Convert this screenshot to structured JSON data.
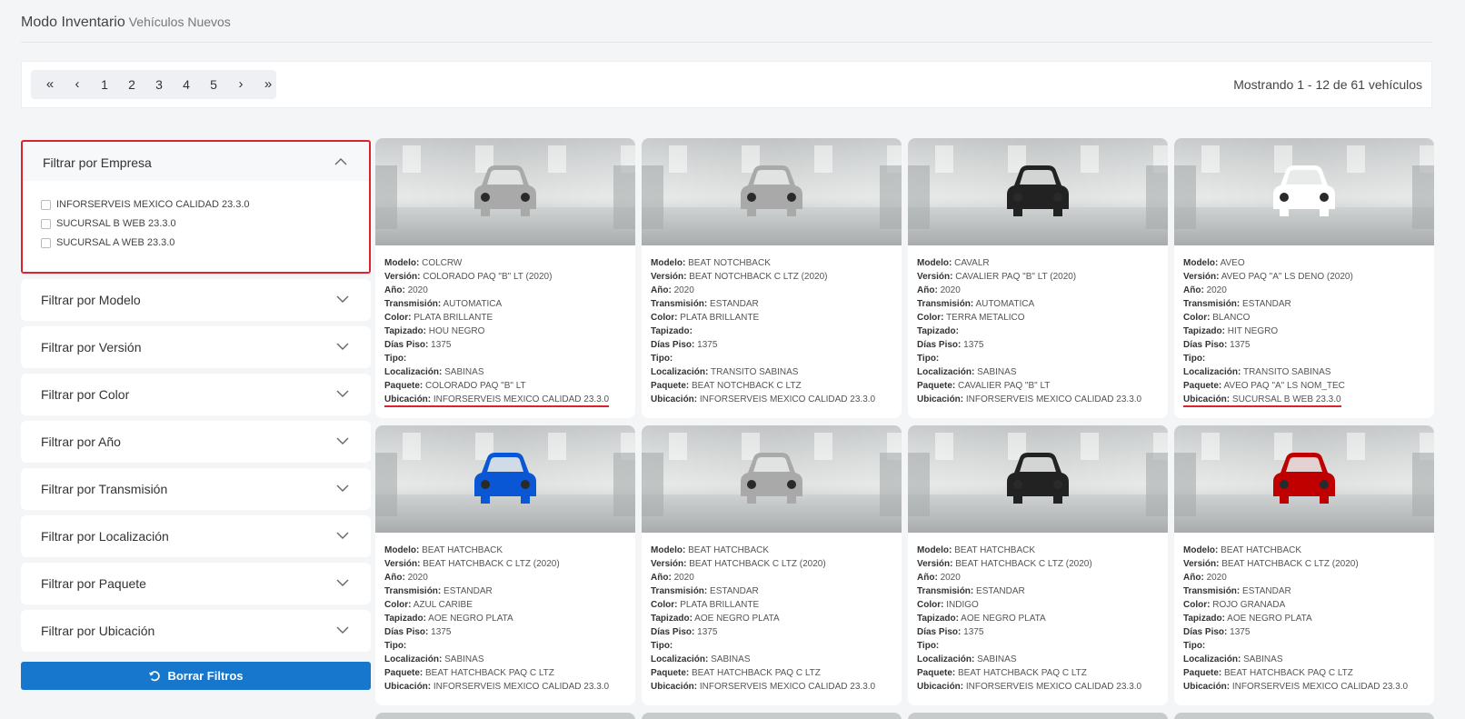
{
  "header": {
    "title": "Modo Inventario",
    "subtitle": "Vehículos Nuevos"
  },
  "pagination": {
    "first": "«",
    "prev": "‹",
    "pages": [
      "1",
      "2",
      "3",
      "4",
      "5"
    ],
    "next": "›",
    "last": "»",
    "showing": "Mostrando 1 - 12 de 61 vehículos"
  },
  "filters": {
    "empresa": {
      "label": "Filtrar por Empresa",
      "options": [
        "INFORSERVEIS MEXICO CALIDAD 23.3.0",
        "SUCURSAL B WEB 23.3.0",
        "SUCURSAL A WEB 23.3.0"
      ]
    },
    "others": [
      "Filtrar por Modelo",
      "Filtrar por Versión",
      "Filtrar por Color",
      "Filtrar por Año",
      "Filtrar por Transmisión",
      "Filtrar por Localización",
      "Filtrar por Paquete",
      "Filtrar por Ubicación"
    ],
    "clear_label": "Borrar Filtros"
  },
  "field_labels": {
    "modelo": "Modelo:",
    "version": "Versión:",
    "anio": "Año:",
    "transmision": "Transmisión:",
    "color": "Color:",
    "tapizado": "Tapizado:",
    "dias": "Días Piso:",
    "tipo": "Tipo:",
    "localizacion": "Localización:",
    "paquete": "Paquete:",
    "ubicacion": "Ubicación:"
  },
  "vehicles": [
    {
      "icon_color": "#a9a9a9",
      "modelo": "COLCRW",
      "version": "COLORADO PAQ \"B\" LT (2020)",
      "anio": "2020",
      "transmision": "AUTOMATICA",
      "color": "PLATA BRILLANTE",
      "tapizado": "HOU NEGRO",
      "dias": "1375",
      "tipo": "",
      "localizacion": "SABINAS",
      "paquete": "COLORADO PAQ \"B\" LT",
      "ubicacion": "INFORSERVEIS MEXICO CALIDAD 23.3.0",
      "highlight": true
    },
    {
      "icon_color": "#a9a9a9",
      "modelo": "BEAT NOTCHBACK",
      "version": "BEAT NOTCHBACK C LTZ (2020)",
      "anio": "2020",
      "transmision": "ESTANDAR",
      "color": "PLATA BRILLANTE",
      "tapizado": "",
      "dias": "1375",
      "tipo": "",
      "localizacion": "TRANSITO SABINAS",
      "paquete": "BEAT NOTCHBACK C LTZ",
      "ubicacion": "INFORSERVEIS MEXICO CALIDAD 23.3.0",
      "highlight": false
    },
    {
      "icon_color": "#222222",
      "modelo": "CAVALR",
      "version": "CAVALIER PAQ \"B\" LT (2020)",
      "anio": "2020",
      "transmision": "AUTOMATICA",
      "color": "TERRA METALICO",
      "tapizado": "",
      "dias": "1375",
      "tipo": "",
      "localizacion": "SABINAS",
      "paquete": "CAVALIER PAQ \"B\" LT",
      "ubicacion": "INFORSERVEIS MEXICO CALIDAD 23.3.0",
      "highlight": false
    },
    {
      "icon_color": "#ffffff",
      "modelo": "AVEO",
      "version": "AVEO PAQ \"A\" LS DENO (2020)",
      "anio": "2020",
      "transmision": "ESTANDAR",
      "color": "BLANCO",
      "tapizado": "HIT NEGRO",
      "dias": "1375",
      "tipo": "",
      "localizacion": "TRANSITO SABINAS",
      "paquete": "AVEO PAQ \"A\" LS NOM_TEC",
      "ubicacion": "SUCURSAL B WEB 23.3.0",
      "highlight": true
    },
    {
      "icon_color": "#0a57d6",
      "modelo": "BEAT HATCHBACK",
      "version": "BEAT HATCHBACK C LTZ (2020)",
      "anio": "2020",
      "transmision": "ESTANDAR",
      "color": "AZUL CARIBE",
      "tapizado": "AOE NEGRO PLATA",
      "dias": "1375",
      "tipo": "",
      "localizacion": "SABINAS",
      "paquete": "BEAT HATCHBACK PAQ C LTZ",
      "ubicacion": "INFORSERVEIS MEXICO CALIDAD 23.3.0",
      "highlight": false
    },
    {
      "icon_color": "#a9a9a9",
      "modelo": "BEAT HATCHBACK",
      "version": "BEAT HATCHBACK C LTZ (2020)",
      "anio": "2020",
      "transmision": "ESTANDAR",
      "color": "PLATA BRILLANTE",
      "tapizado": "AOE NEGRO PLATA",
      "dias": "1375",
      "tipo": "",
      "localizacion": "SABINAS",
      "paquete": "BEAT HATCHBACK PAQ C LTZ",
      "ubicacion": "INFORSERVEIS MEXICO CALIDAD 23.3.0",
      "highlight": false
    },
    {
      "icon_color": "#222222",
      "modelo": "BEAT HATCHBACK",
      "version": "BEAT HATCHBACK C LTZ (2020)",
      "anio": "2020",
      "transmision": "ESTANDAR",
      "color": "INDIGO",
      "tapizado": "AOE NEGRO PLATA",
      "dias": "1375",
      "tipo": "",
      "localizacion": "SABINAS",
      "paquete": "BEAT HATCHBACK PAQ C LTZ",
      "ubicacion": "INFORSERVEIS MEXICO CALIDAD 23.3.0",
      "highlight": false
    },
    {
      "icon_color": "#c00000",
      "modelo": "BEAT HATCHBACK",
      "version": "BEAT HATCHBACK C LTZ (2020)",
      "anio": "2020",
      "transmision": "ESTANDAR",
      "color": "ROJO GRANADA",
      "tapizado": "AOE NEGRO PLATA",
      "dias": "1375",
      "tipo": "",
      "localizacion": "SABINAS",
      "paquete": "BEAT HATCHBACK PAQ C LTZ",
      "ubicacion": "INFORSERVEIS MEXICO CALIDAD 23.3.0",
      "highlight": false
    }
  ]
}
